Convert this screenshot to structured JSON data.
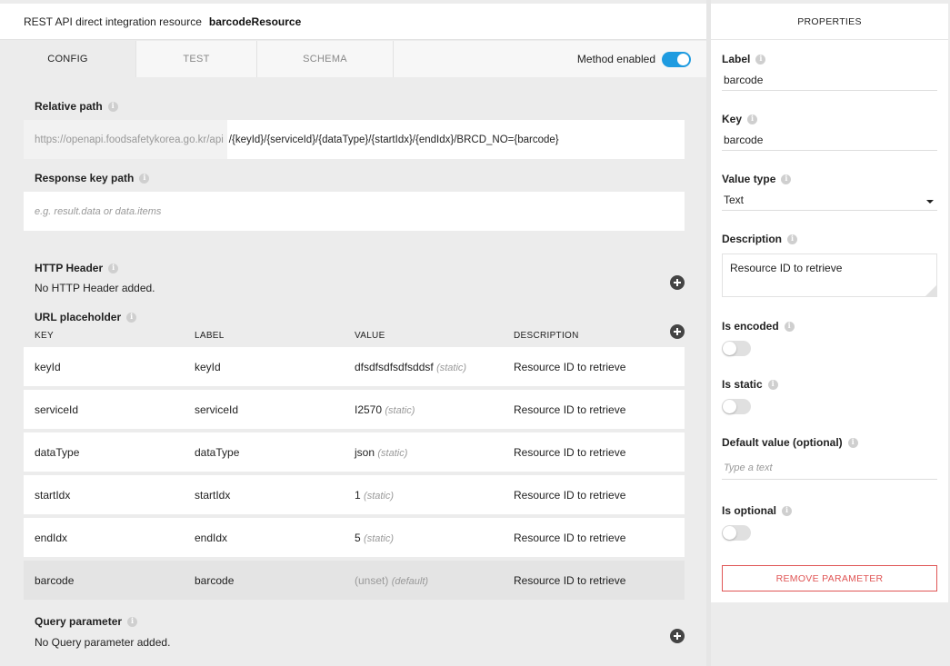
{
  "header": {
    "prefix": "REST API direct integration resource",
    "resource_name": "barcodeResource"
  },
  "tabs": [
    {
      "label": "CONFIG",
      "active": true
    },
    {
      "label": "TEST",
      "active": false
    },
    {
      "label": "SCHEMA",
      "active": false
    }
  ],
  "method_enabled": {
    "label": "Method enabled",
    "on": true,
    "color": "#1e9be0"
  },
  "relative_path": {
    "label": "Relative path",
    "base": "https://openapi.foodsafetykorea.go.kr/api",
    "path": "/{keyId}/{serviceId}/{dataType}/{startIdx}/{endIdx}/BRCD_NO={barcode}"
  },
  "response_key_path": {
    "label": "Response key path",
    "placeholder": "e.g. result.data or data.items"
  },
  "http_header": {
    "label": "HTTP Header",
    "empty_text": "No HTTP Header added."
  },
  "url_placeholder": {
    "label": "URL placeholder",
    "columns": [
      "KEY",
      "LABEL",
      "VALUE",
      "DESCRIPTION"
    ],
    "rows": [
      {
        "key": "keyId",
        "label": "keyId",
        "value": "dfsdfsdfsdfsddsf",
        "tag": "(static)",
        "description": "Resource ID to retrieve"
      },
      {
        "key": "serviceId",
        "label": "serviceId",
        "value": "I2570",
        "tag": "(static)",
        "description": "Resource ID to retrieve"
      },
      {
        "key": "dataType",
        "label": "dataType",
        "value": "json",
        "tag": "(static)",
        "description": "Resource ID to retrieve"
      },
      {
        "key": "startIdx",
        "label": "startIdx",
        "value": "1",
        "tag": "(static)",
        "description": "Resource ID to retrieve"
      },
      {
        "key": "endIdx",
        "label": "endIdx",
        "value": "5",
        "tag": "(static)",
        "description": "Resource ID to retrieve"
      },
      {
        "key": "barcode",
        "label": "barcode",
        "value": "(unset)",
        "tag": "(default)",
        "description": "Resource ID to retrieve",
        "selected": true
      }
    ]
  },
  "query_parameter": {
    "label": "Query parameter",
    "empty_text": "No Query parameter added."
  },
  "properties": {
    "title": "PROPERTIES",
    "label_field": {
      "label": "Label",
      "value": "barcode"
    },
    "key_field": {
      "label": "Key",
      "value": "barcode"
    },
    "value_type": {
      "label": "Value type",
      "value": "Text"
    },
    "description": {
      "label": "Description",
      "value": "Resource ID to retrieve"
    },
    "is_encoded": {
      "label": "Is encoded",
      "on": false
    },
    "is_static": {
      "label": "Is static",
      "on": false
    },
    "default_value": {
      "label": "Default value (optional)",
      "placeholder": "Type a text"
    },
    "is_optional": {
      "label": "Is optional",
      "on": false
    },
    "remove_button": "REMOVE PARAMETER"
  },
  "icons": {
    "info": "info-icon",
    "add": "plus-circle-icon",
    "dropdown": "caret-down-icon"
  }
}
